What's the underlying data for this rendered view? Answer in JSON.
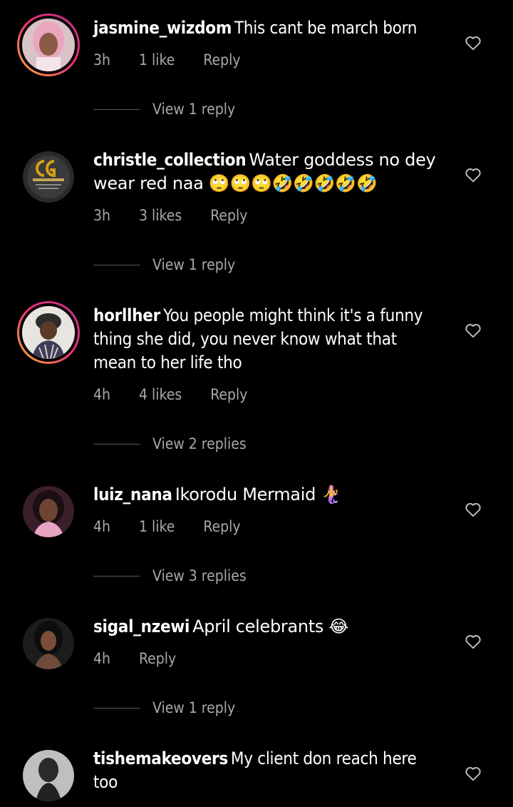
{
  "comments": [
    {
      "username": "jasmine_wizdom",
      "text": "This cant be march born",
      "time": "3h",
      "likes": "1 like",
      "reply_label": "Reply",
      "view_replies": "View 1 reply",
      "avatar_icon": "profile-photo-woman-pink-hair",
      "has_story_ring": true
    },
    {
      "username": "christle_collection",
      "text": "Water goddess no dey wear red naa 🙄🙄🙄🤣🤣🤣🤣🤣",
      "time": "3h",
      "likes": "3 likes",
      "reply_label": "Reply",
      "view_replies": "View 1 reply",
      "avatar_icon": "christle-collection-logo",
      "has_story_ring": false
    },
    {
      "username": "horllher",
      "text": "You people might think it's a funny thing she did, you never know what that mean to her life tho",
      "time": "4h",
      "likes": "4 likes",
      "reply_label": "Reply",
      "view_replies": "View 2 replies",
      "avatar_icon": "profile-photo-person-headwrap",
      "has_story_ring": true
    },
    {
      "username": "luiz_nana",
      "text": "Ikorodu Mermaid 🧜‍♀️",
      "time": "4h",
      "likes": "1 like",
      "reply_label": "Reply",
      "view_replies": "View 3 replies",
      "avatar_icon": "profile-photo-woman-pink-light",
      "has_story_ring": false
    },
    {
      "username": "sigal_nzewi",
      "text": "April celebrants 😂",
      "time": "4h",
      "likes": "",
      "reply_label": "Reply",
      "view_replies": "View 1 reply",
      "avatar_icon": "profile-photo-woman-dark",
      "has_story_ring": false
    },
    {
      "username": "tishemakeovers",
      "text": "My client don reach here too",
      "time": "",
      "likes": "",
      "reply_label": "",
      "view_replies": "",
      "avatar_icon": "profile-photo-woman-grey",
      "has_story_ring": false
    }
  ],
  "colors": {
    "background": "#000000",
    "text_primary": "#ffffff",
    "text_secondary": "#a8a8a8",
    "story_ring_start": "#f9b234",
    "story_ring_end": "#c13584"
  },
  "icons": {
    "like": "heart-outline-icon"
  }
}
